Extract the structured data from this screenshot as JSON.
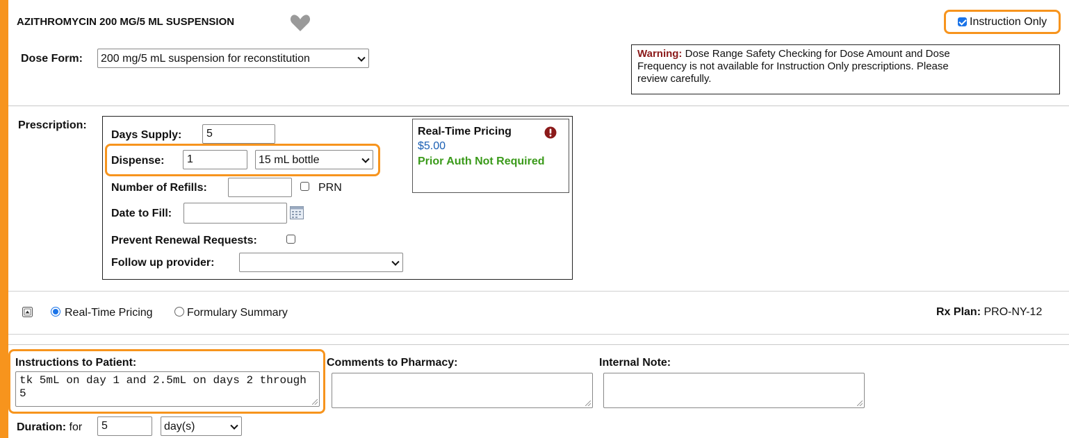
{
  "drug": {
    "title": "AZITHROMYCIN 200 MG/5 ML SUSPENSION",
    "favorite_icon": "heart-icon"
  },
  "instruction_only": {
    "label": "Instruction Only",
    "checked": true
  },
  "dose_form": {
    "label": "Dose Form:",
    "value": "200 mg/5 mL suspension for reconstitution"
  },
  "warning": {
    "prefix": "Warning:",
    "line1": " Dose Range Safety Checking for Dose Amount and Dose",
    "line2": "Frequency is not available for Instruction Only prescriptions. Please",
    "line3": "review carefully."
  },
  "prescription": {
    "label": "Prescription:",
    "days_supply": {
      "label": "Days Supply:",
      "value": "5"
    },
    "dispense": {
      "label": "Dispense:",
      "value": "1",
      "unit": "15 mL bottle"
    },
    "refills": {
      "label": "Number of Refills:",
      "value": "",
      "prn_label": "PRN"
    },
    "date_to_fill": {
      "label": "Date to Fill:",
      "value": "",
      "icon": "calendar-icon"
    },
    "prevent_renewal": {
      "label": "Prevent Renewal Requests:"
    },
    "follow_up": {
      "label": "Follow up provider:",
      "value": ""
    }
  },
  "pricing": {
    "title": "Real-Time Pricing",
    "alert_icon": "exclamation-icon",
    "price": "$5.00",
    "prior_auth": "Prior Auth Not Required"
  },
  "pricing_toggle": {
    "collapse_icon": "collapse-icon",
    "options": [
      {
        "label": "Real-Time Pricing",
        "selected": true
      },
      {
        "label": "Formulary Summary",
        "selected": false
      }
    ],
    "rx_plan_label": "Rx Plan:",
    "rx_plan_value": " PRO-NY-12"
  },
  "notes": {
    "instructions_label": "Instructions to Patient:",
    "instructions_value": "tk 5mL on day 1 and 2.5mL on days 2 through 5",
    "comments_label": "Comments to Pharmacy:",
    "comments_value": "",
    "internal_label": "Internal Note:",
    "internal_value": ""
  },
  "duration": {
    "label": "Duration:",
    "for_text": " for",
    "value": "5",
    "unit": "day(s)"
  },
  "colors": {
    "highlight": "#f7941d",
    "warning": "#8b1a1a",
    "price": "#1a5fb4",
    "prior_auth": "#3a9a1a",
    "checkbox": "#1a73e8"
  }
}
